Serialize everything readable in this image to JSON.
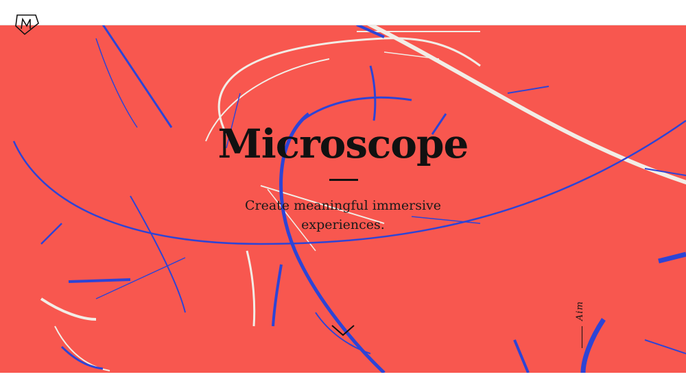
{
  "brand": {
    "logo_icon": "microscope-monogram-logo"
  },
  "hero": {
    "title": "Microscope",
    "tagline": "Create meaningful immersive experiences.",
    "scroll_icon": "chevron-down-icon"
  },
  "side_nav": {
    "aim_label": "Aim"
  },
  "colors": {
    "background": "#f8574f",
    "stroke_blue": "#2d44d6",
    "stroke_white": "#f2ede6",
    "ink": "#111111"
  }
}
